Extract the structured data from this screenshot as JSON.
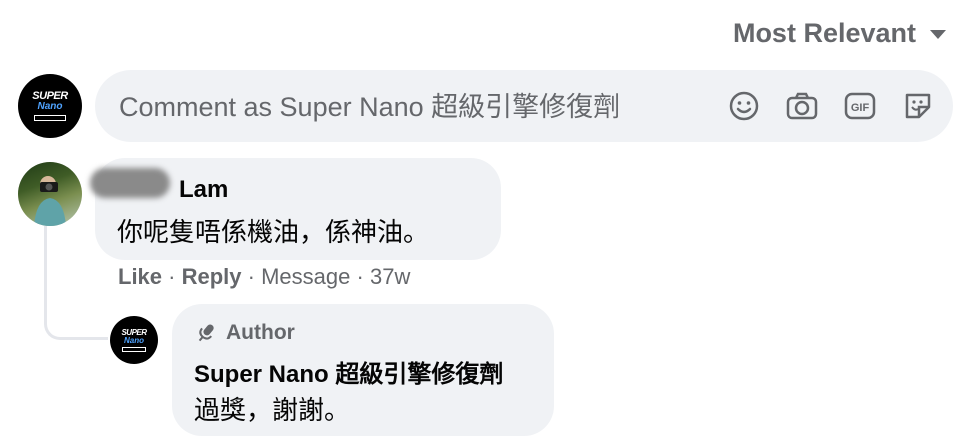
{
  "sort": {
    "label": "Most Relevant"
  },
  "composer": {
    "placeholder": "Comment as Super Nano 超級引擎修復劑",
    "icons": [
      "emoji-icon",
      "camera-icon",
      "gif-icon",
      "sticker-icon"
    ]
  },
  "page_avatar": {
    "brand_top": "SUPER",
    "brand_bottom": "Nano"
  },
  "comment": {
    "author_visible": "Lam",
    "text": "你呢隻唔係機油，係神油。",
    "actions": {
      "like": "Like",
      "reply": "Reply",
      "message": "Message",
      "time": "37w"
    }
  },
  "reply": {
    "badge": "Author",
    "author": "Super Nano 超級引擎修復劑",
    "text": "過獎，謝謝。"
  }
}
